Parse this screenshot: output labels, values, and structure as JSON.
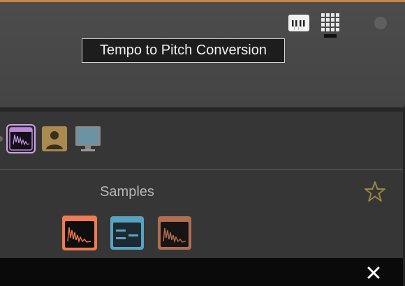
{
  "header": {
    "tooltip": "Tempo to Pitch Conversion",
    "icons": [
      "piano-keyboard-icon",
      "grid-pad-icon",
      "status-dot"
    ]
  },
  "toolbar": {
    "icons": [
      "sample-waveform-icon",
      "user-icon",
      "monitor-icon"
    ],
    "selected": "sample-waveform-icon"
  },
  "samples": {
    "title": "Samples",
    "tiles": [
      "sample-waveform-icon",
      "list-icon",
      "sample-waveform-icon"
    ],
    "favorite": "star-icon"
  },
  "footer": {
    "close": "close-icon"
  },
  "colors": {
    "accent": "#c7874a",
    "sample_orange": "#f07a52",
    "sample_blue": "#5aa2c2",
    "sample_brown": "#b06f53",
    "selected_purple": "#b88ad3",
    "star_gold": "#9a8543"
  }
}
